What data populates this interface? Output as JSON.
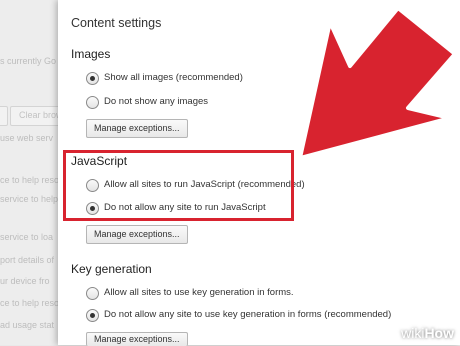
{
  "background": {
    "lines": [
      "s currently Go",
      "Clear brow",
      "use web serv",
      "ce to help reso",
      "service to help",
      "service to loa",
      "port details of",
      "ur device fro",
      "ce to help resol",
      "ad usage stat"
    ]
  },
  "dialog": {
    "title": "Content settings",
    "images": {
      "heading": "Images",
      "options": [
        {
          "label": "Show all images (recommended)",
          "selected": true
        },
        {
          "label": "Do not show any images",
          "selected": false
        }
      ],
      "manage_label": "Manage exceptions..."
    },
    "javascript": {
      "heading": "JavaScript",
      "options": [
        {
          "label": "Allow all sites to run JavaScript (recommended)",
          "selected": false
        },
        {
          "label": "Do not allow any site to run JavaScript",
          "selected": true
        }
      ],
      "manage_label": "Manage exceptions..."
    },
    "keygen": {
      "heading": "Key generation",
      "options": [
        {
          "label": "Allow all sites to use key generation in forms.",
          "selected": false
        },
        {
          "label": "Do not allow any site to use key generation in forms (recommended)",
          "selected": true
        }
      ],
      "manage_label": "Manage exceptions..."
    }
  },
  "annotation": {
    "color": "#d8232f"
  },
  "watermark": {
    "prefix": "wiki",
    "brand": "How"
  }
}
